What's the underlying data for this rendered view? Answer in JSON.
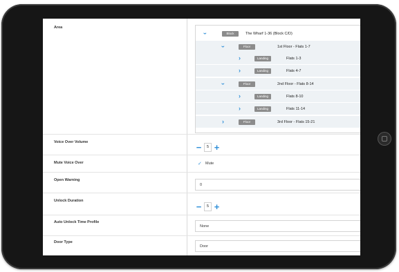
{
  "form": {
    "area_label": "Area",
    "voice_over_volume_label": "Voice Over Volume",
    "mute_voice_over_label": "Mute Voice Over",
    "open_warning_label": "Open Warning",
    "unlock_duration_label": "Unlock Duration",
    "auto_unlock_label": "Auto Unlock Time Profile",
    "door_type_label": "Door Type"
  },
  "tree": [
    {
      "badge": "Block",
      "text": "The Wharf 1-36 (Block C/D)",
      "expanded": true
    },
    {
      "badge": "Floor",
      "text": "1st Floor - Flats 1-7",
      "expanded": true
    },
    {
      "badge": "Landing",
      "text": "Flats 1-3",
      "expanded": false
    },
    {
      "badge": "Landing",
      "text": "Flats 4-7",
      "expanded": false
    },
    {
      "badge": "Floor",
      "text": "2nd Floor - Flats 8-14",
      "expanded": true
    },
    {
      "badge": "Landing",
      "text": "Flats 8-10",
      "expanded": false
    },
    {
      "badge": "Landing",
      "text": "Flats 11-14",
      "expanded": false
    },
    {
      "badge": "Floor",
      "text": "3rd Floor - Flats 15-21",
      "expanded": false
    }
  ],
  "voice_over_volume": {
    "minus": "−",
    "value": "5",
    "plus": "+"
  },
  "mute_voice_over": {
    "checked": true,
    "check": "✓",
    "label": "Mute"
  },
  "open_warning": {
    "value": "0"
  },
  "unlock_duration": {
    "minus": "−",
    "value": "5",
    "plus": "+"
  },
  "auto_unlock_time_profile": {
    "value": "None"
  },
  "door_type": {
    "value": "Door"
  }
}
